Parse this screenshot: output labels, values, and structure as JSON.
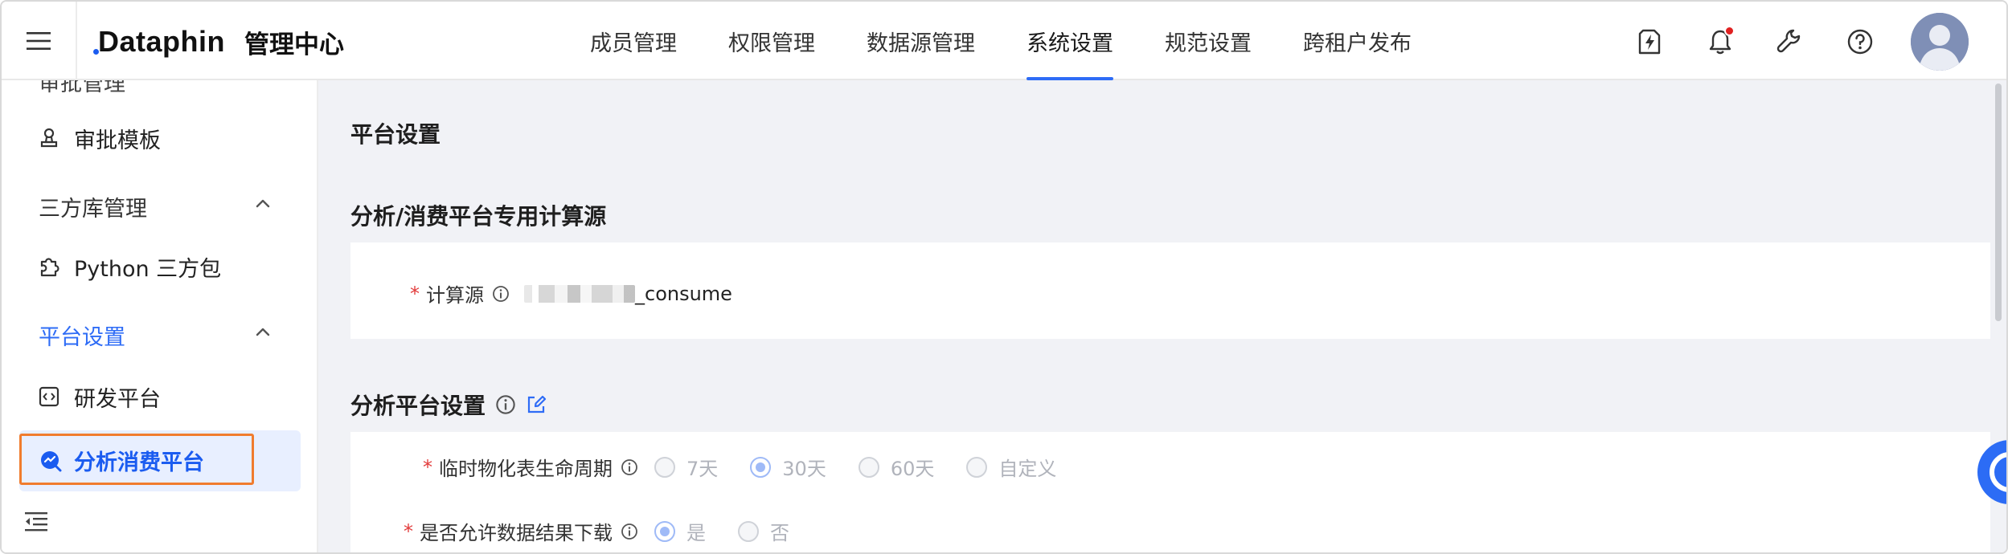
{
  "header": {
    "brand_logo": "Dataphin",
    "brand_sub": "管理中心",
    "nav": [
      {
        "label": "成员管理"
      },
      {
        "label": "权限管理"
      },
      {
        "label": "数据源管理"
      },
      {
        "label": "系统设置",
        "active": true
      },
      {
        "label": "规范设置"
      },
      {
        "label": "跨租户发布"
      }
    ],
    "accent_color": "#2e6cf6",
    "icons": [
      "menu-icon",
      "flash-icon",
      "bell-icon",
      "wrench-icon",
      "help-icon",
      "avatar"
    ]
  },
  "sidebar": {
    "top_cut_label": "审批管理",
    "items": [
      {
        "label": "审批模板",
        "icon": "approval-stamp-icon"
      },
      {
        "label": "三方库管理",
        "type": "group"
      },
      {
        "label": "Python 三方包",
        "icon": "puzzle-icon"
      },
      {
        "label": "平台设置",
        "type": "group",
        "active": true
      },
      {
        "label": "研发平台",
        "icon": "code-icon"
      },
      {
        "label": "分析消费平台",
        "icon": "analysis-icon",
        "selected": true
      }
    ],
    "highlight_color": "#f07c2e"
  },
  "main": {
    "page_title": "平台设置",
    "compute_section": {
      "title": "分析/消费平台专用计算源",
      "field_label": "计算源",
      "field_value_suffix": "_consume"
    },
    "analysis_section": {
      "title": "分析平台设置",
      "lifecycle": {
        "label": "临时物化表生命周期",
        "options": [
          "7天",
          "30天",
          "60天",
          "自定义"
        ],
        "selected": "30天"
      },
      "download": {
        "label": "是否允许数据结果下载",
        "options": [
          "是",
          "否"
        ],
        "selected": "是"
      }
    }
  }
}
